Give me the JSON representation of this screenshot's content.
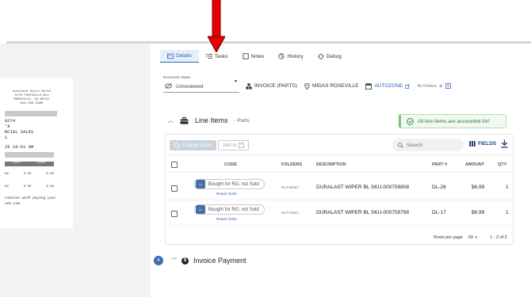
{
  "tabs": [
    {
      "label": "Details",
      "icon": "details-icon",
      "active": true
    },
    {
      "label": "Tasks",
      "icon": "tasks-icon"
    },
    {
      "label": "Notes",
      "icon": "notes-icon"
    },
    {
      "label": "History",
      "icon": "history-icon"
    },
    {
      "label": "Debug",
      "icon": "debug-icon"
    }
  ],
  "doc_status": {
    "label": "Document Status",
    "value": "Unreviewed"
  },
  "meta": {
    "invoice_type": "INVOICE (PARTS)",
    "location": "MIDAS ROSEVILLE",
    "vendor": "AUTOZONE",
    "folders": "No Folders"
  },
  "line_items": {
    "title": "Line Items",
    "subtitle": "- Parts",
    "accounted_text": "All line items are accounted for!"
  },
  "toolbar": {
    "change_code": "Change Code",
    "add_to": "Add to",
    "search_placeholder": "Search",
    "fields": "FIELDS"
  },
  "columns": {
    "code": "CODE",
    "folders": "FOLDERS",
    "description": "DESCRIPTION",
    "part": "PART #",
    "amount": "AMOUNT",
    "qty": "QTY"
  },
  "rows": [
    {
      "code": "Bought for RO, not Sold",
      "repair": "Repair Order",
      "folders": "No Folders",
      "description": "DURALAST WIPER BL SKU-000759808",
      "part": "DL-26",
      "amount": "$6.99",
      "qty": "1"
    },
    {
      "code": "Bought for RO, not Sold",
      "repair": "Repair Order",
      "folders": "No Folders",
      "description": "DURALAST WIPER BL SKU-000759798",
      "part": "DL-17",
      "amount": "$6.99",
      "qty": "1"
    }
  ],
  "pager": {
    "rows_per_page_label": "Rows per page",
    "rows_per_page": "50",
    "range": "1 - 2 of 2"
  },
  "invoice_payment": {
    "badge": "8",
    "title": "Invoice Payment"
  },
  "receipt": {
    "header": [
      "AutoZone Store 05710",
      "5170 FOOTHILLS BLV",
      "ROSEVILLE, CA 95747",
      "916.843.5985"
    ],
    "line1": "8274",
    "line2": "'8",
    "line3": "RCIAL SALES",
    "line4": "1",
    "time": "25 10:51 AM",
    "col1": "Core",
    "col2": "Total",
    "rows": [
      [
        "99",
        "0.00",
        "6.99"
      ],
      [
        "99",
        "0.00",
        "6.99"
      ]
    ],
    "foot1": "ciation with paying your",
    "foot2": "one.com."
  },
  "colors": {
    "accent": "#2b5fb7",
    "success": "#2e7d32",
    "arrow": "#e60000"
  }
}
